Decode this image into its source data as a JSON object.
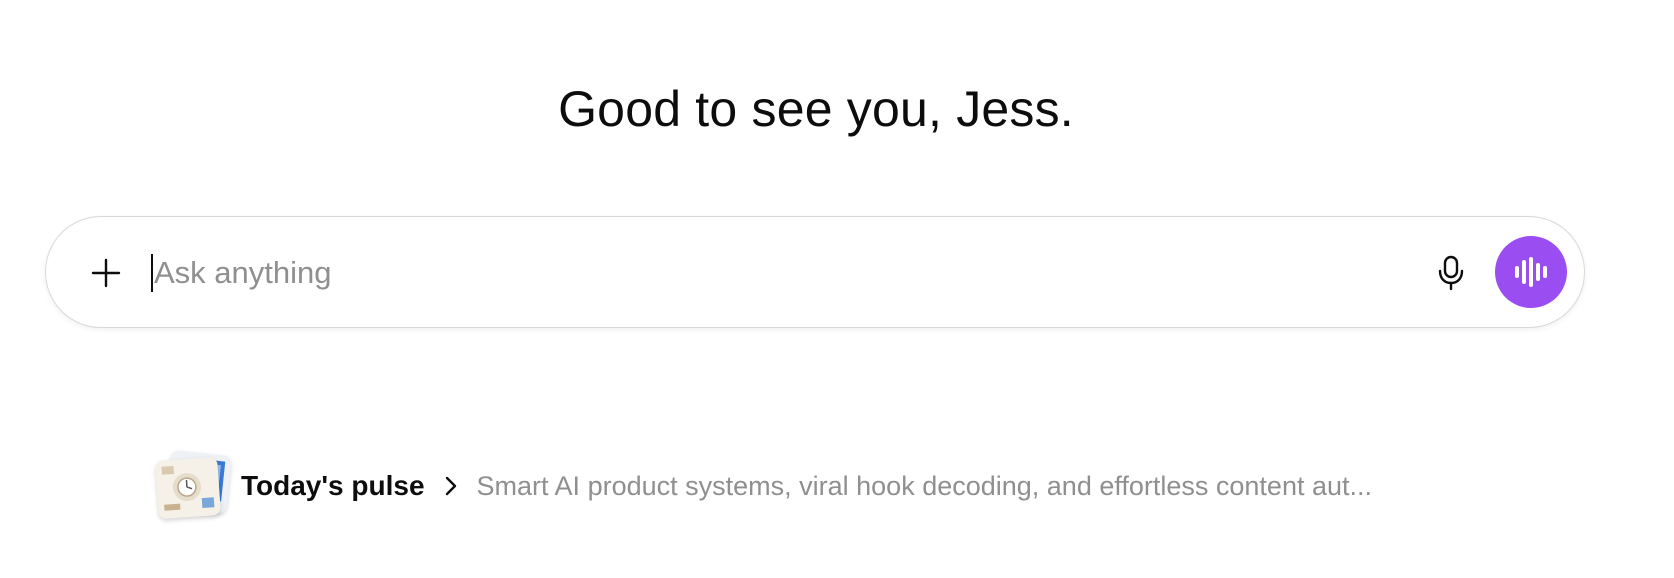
{
  "greeting": "Good to see you, Jess.",
  "composer": {
    "placeholder": "Ask anything",
    "value": "",
    "icons": {
      "add": "plus-icon",
      "dictate": "microphone-icon",
      "voice_mode": "waveform-icon"
    },
    "accent_color": "#9a4df0"
  },
  "pulse": {
    "title": "Today's pulse",
    "summary": "Smart AI product systems, viral hook decoding, and effortless content aut...",
    "chevron_icon": "chevron-right-icon"
  }
}
